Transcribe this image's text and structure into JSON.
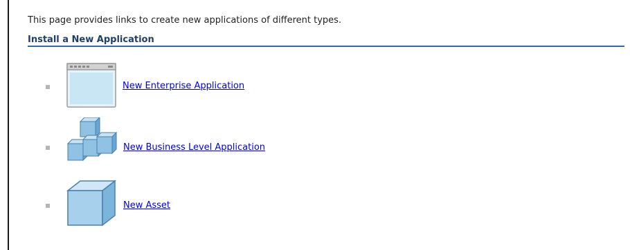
{
  "intro_text": "This page provides links to create new applications of different types.",
  "section": {
    "title": "Install a New Application"
  },
  "items": [
    {
      "label": "New Enterprise Application",
      "icon": "window-icon"
    },
    {
      "label": "New Business Level Application",
      "icon": "stacked-cubes-icon"
    },
    {
      "label": "New Asset",
      "icon": "cube-icon"
    }
  ],
  "colors": {
    "link": "#0000ee",
    "heading": "#1f3f6b",
    "rule": "#2d6aa8",
    "bullet": "#b5b5b5",
    "icon_blue": "#9cc8e6",
    "icon_outline": "#4b7fae"
  }
}
